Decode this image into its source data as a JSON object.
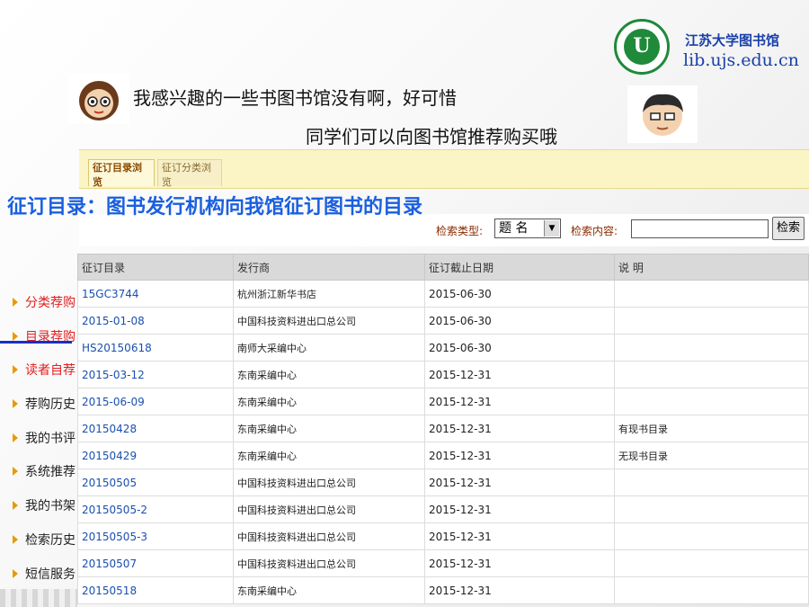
{
  "header": {
    "library_name": "江苏大学图书馆",
    "library_url": "lib.ujs.edu.cn",
    "logo_icon": "jiangsu-university-logo"
  },
  "speech": {
    "line1": "我感兴趣的一些书图书馆没有啊，好可惜",
    "line2": "同学们可以向图书馆推荐购买哦"
  },
  "tabs": [
    {
      "label": "征订目录浏览",
      "active": true
    },
    {
      "label": "征订分类浏览",
      "active": false
    }
  ],
  "heading": "征订目录：图书发行机构向我馆征订图书的目录",
  "search": {
    "type_label": "检索类型:",
    "type_value": "题 名",
    "content_label": "检索内容:",
    "input_value": "",
    "button_label": "检索"
  },
  "table": {
    "headers": [
      "征订目录",
      "发行商",
      "征订截止日期",
      "说 明"
    ],
    "rows": [
      [
        "15GC3744",
        "杭州浙江新华书店",
        "2015-06-30",
        ""
      ],
      [
        "2015-01-08",
        "中国科技资料进出口总公司",
        "2015-06-30",
        ""
      ],
      [
        "HS20150618",
        "南师大采编中心",
        "2015-06-30",
        ""
      ],
      [
        "2015-03-12",
        "东南采编中心",
        "2015-12-31",
        ""
      ],
      [
        "2015-06-09",
        "东南采编中心",
        "2015-12-31",
        ""
      ],
      [
        "20150428",
        "东南采编中心",
        "2015-12-31",
        "有现书目录"
      ],
      [
        "20150429",
        "东南采编中心",
        "2015-12-31",
        "无现书目录"
      ],
      [
        "20150505",
        "中国科技资料进出口总公司",
        "2015-12-31",
        ""
      ],
      [
        "20150505-2",
        "中国科技资料进出口总公司",
        "2015-12-31",
        ""
      ],
      [
        "20150505-3",
        "中国科技资料进出口总公司",
        "2015-12-31",
        ""
      ],
      [
        "20150507",
        "中国科技资料进出口总公司",
        "2015-12-31",
        ""
      ],
      [
        "20150518",
        "东南采编中心",
        "2015-12-31",
        ""
      ]
    ]
  },
  "sidebar": {
    "items": [
      {
        "label": "分类荐购",
        "highlight": true
      },
      {
        "label": "目录荐购",
        "highlight": true,
        "active": true
      },
      {
        "label": "读者自荐",
        "highlight": true
      },
      {
        "label": "荐购历史",
        "highlight": false
      },
      {
        "label": "我的书评",
        "highlight": false
      },
      {
        "label": "系统推荐",
        "highlight": false
      },
      {
        "label": "我的书架",
        "highlight": false
      },
      {
        "label": "检索历史",
        "highlight": false
      },
      {
        "label": "短信服务",
        "highlight": false
      }
    ]
  },
  "colors": {
    "accent_blue": "#1a5fe0",
    "link_blue": "#1a4fb0",
    "highlight_red": "#e02020",
    "tab_bar": "#fbf4c5",
    "logo_green": "#1e8a3a"
  }
}
